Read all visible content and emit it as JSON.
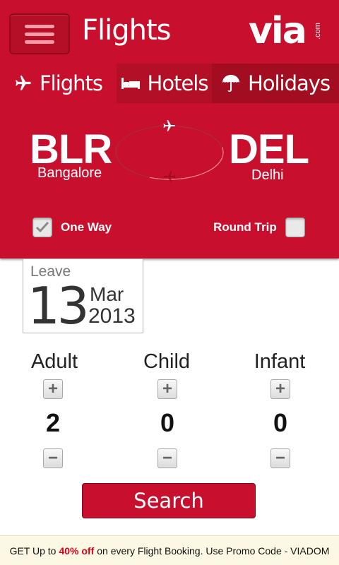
{
  "header": {
    "title": "Flights",
    "logo_text": "via",
    "logo_suffix": ".com",
    "menu_icon": "hamburger-icon"
  },
  "tabs": [
    {
      "label": "Flights",
      "icon": "airplane-icon",
      "active": true
    },
    {
      "label": "Hotels",
      "icon": "bed-icon",
      "active": false
    },
    {
      "label": "Holidays",
      "icon": "umbrella-icon",
      "active": false
    }
  ],
  "route": {
    "from_code": "BLR",
    "from_city": "Bangalore",
    "to_code": "DEL",
    "to_city": "Delhi"
  },
  "trip_type": {
    "one_way_label": "One Way",
    "one_way_checked": true,
    "round_trip_label": "Round Trip",
    "round_trip_checked": false
  },
  "date": {
    "label": "Leave",
    "day": "13",
    "month": "Mar",
    "year": "2013"
  },
  "passengers": [
    {
      "label": "Adult",
      "count": "2"
    },
    {
      "label": "Child",
      "count": "0"
    },
    {
      "label": "Infant",
      "count": "0"
    }
  ],
  "search_label": "Search",
  "promo": {
    "prefix": "GET Up to",
    "highlight": "40% off",
    "suffix": "on every Flight Booking. Use Promo Code - VIADOM"
  },
  "colors": {
    "brand_red": "#c8102e",
    "tab_dark": "#a30d21",
    "promo_bg": "#fdf8e3",
    "promo_highlight": "#d0021b"
  }
}
